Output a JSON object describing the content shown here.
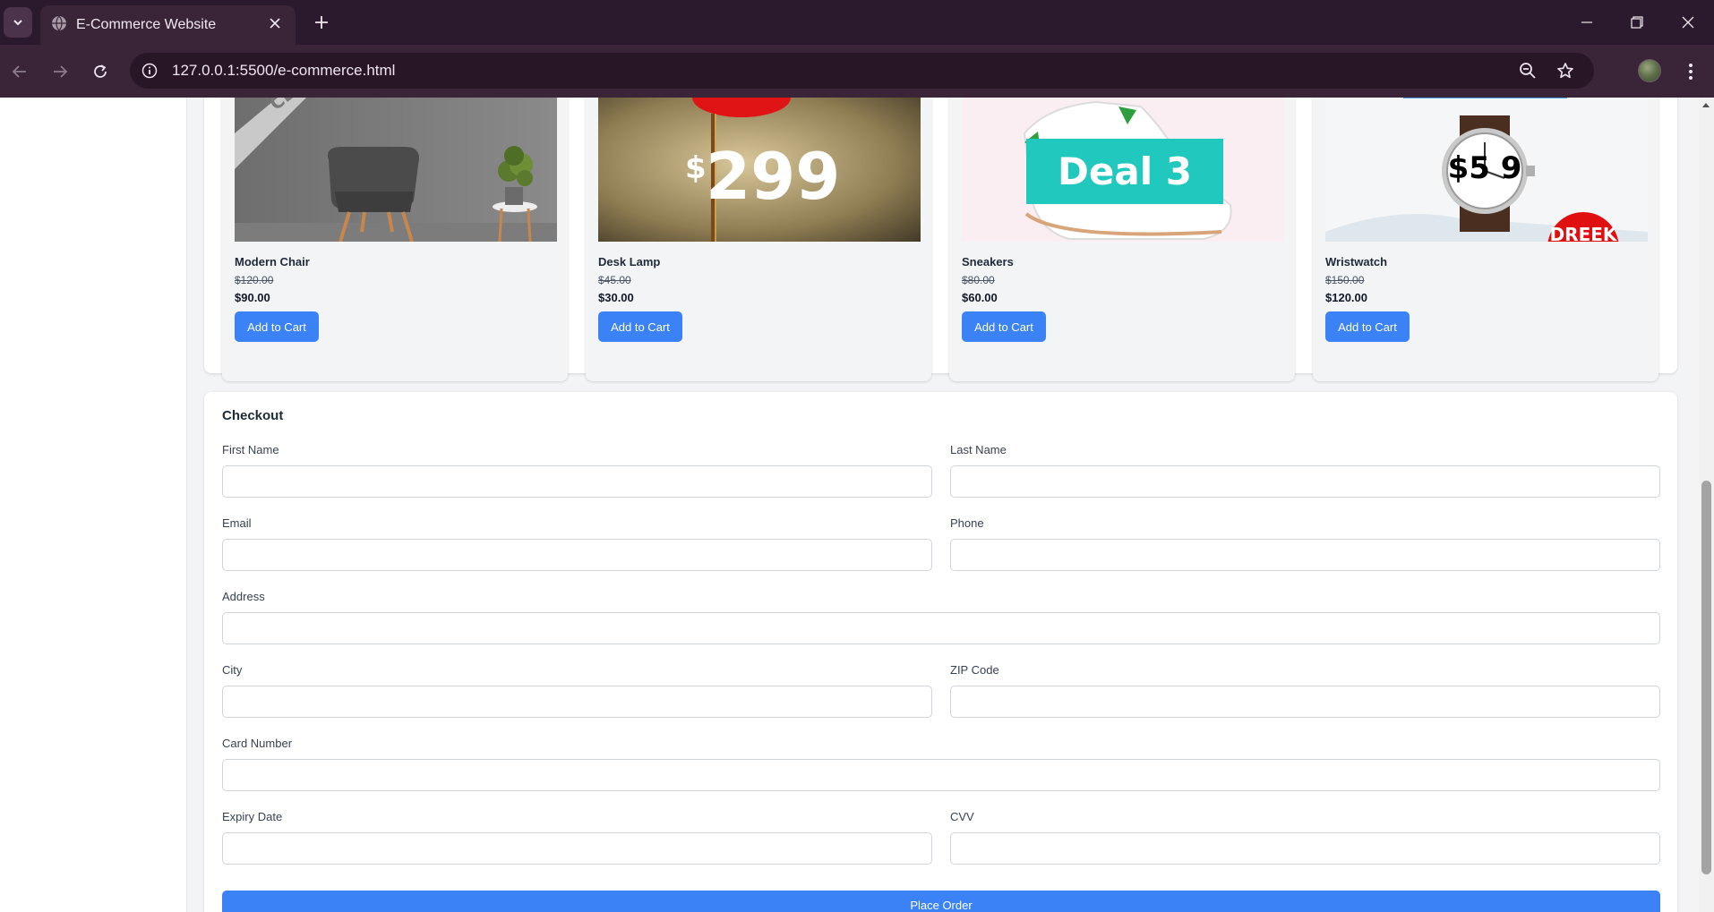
{
  "browser": {
    "tab_title": "E-Commerce Website",
    "url": "127.0.0.1:5500/e-commerce.html"
  },
  "products": [
    {
      "name": "Modern Chair",
      "old_price": "$120.00",
      "price": "$90.00",
      "button": "Add to Cart",
      "image_text": "CL"
    },
    {
      "name": "Desk Lamp",
      "old_price": "$45.00",
      "price": "$30.00",
      "button": "Add to Cart",
      "image_text": "299",
      "image_currency": "$"
    },
    {
      "name": "Sneakers",
      "old_price": "$80.00",
      "price": "$60.00",
      "button": "Add to Cart",
      "image_text": "Deal 3"
    },
    {
      "name": "Wristwatch",
      "old_price": "$150.00",
      "price": "$120.00",
      "button": "Add to Cart",
      "image_text": "$5 9",
      "image_badge": "DREEK"
    }
  ],
  "checkout": {
    "title": "Checkout",
    "fields": {
      "first_name": "First Name",
      "last_name": "Last Name",
      "email": "Email",
      "phone": "Phone",
      "address": "Address",
      "city": "City",
      "zip": "ZIP Code",
      "card_number": "Card Number",
      "expiry": "Expiry Date",
      "cvv": "CVV"
    },
    "submit": "Place Order"
  },
  "colors": {
    "accent": "#3b82f6",
    "page_bg": "#f3f4f6",
    "chrome_dark": "#2b1a2d",
    "chrome_toolbar": "#3a2438",
    "deal_teal": "#20c8bd"
  }
}
